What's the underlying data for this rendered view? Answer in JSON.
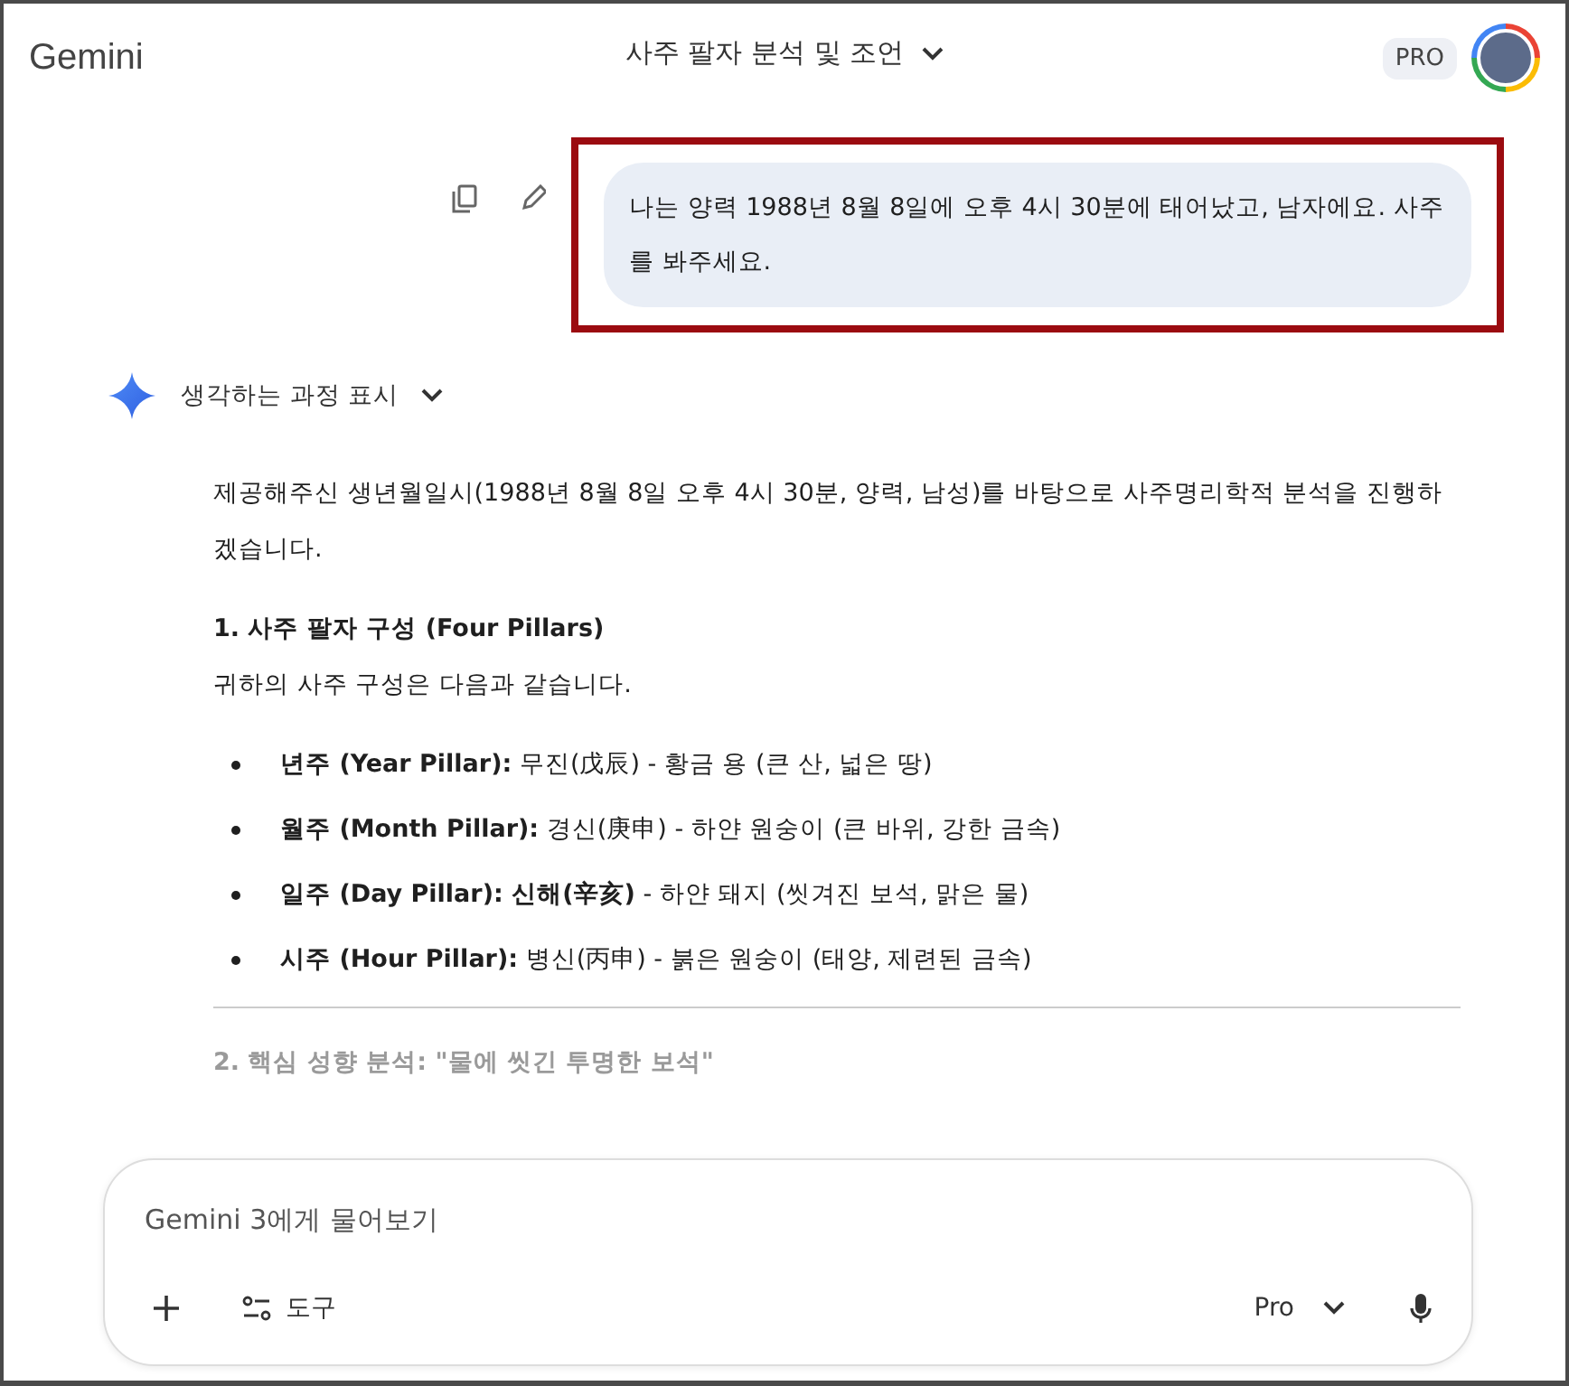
{
  "header": {
    "logo": "Gemini",
    "title": "사주 팔자 분석 및 조언",
    "badge": "PRO"
  },
  "user_message": {
    "text": "나는 양력 1988년 8월 8일에 오후 4시 30분에 태어났고, 남자에요. 사주를 봐주세요.",
    "highlighted": true
  },
  "thinking": {
    "label": "생각하는 과정 표시",
    "expanded": false
  },
  "response": [
    {
      "kind": "paragraph",
      "text": "제공해주신 생년월일시(1988년 8월 8일 오후 4시 30분, 양력, 남성)를 바탕으로 사주명리학적 분석을 진행하겠습니다."
    },
    {
      "kind": "heading",
      "text": "1. 사주 팔자 구성 (Four Pillars)"
    },
    {
      "kind": "paragraph",
      "text": "귀하의 사주 구성은 다음과 같습니다."
    },
    {
      "kind": "bullet",
      "text": "**년주 (Year Pillar):** 무진(戊辰) - 황금 용 (큰 산, 넓은 땅)"
    },
    {
      "kind": "bullet",
      "text": "**월주 (Month Pillar):** 경신(庚申) - 하얀 원숭이 (큰 바위, 강한 금속)"
    },
    {
      "kind": "bullet",
      "text": "**일주 (Day Pillar): 신해(辛亥)** - 하얀 돼지 (씻겨진 보석, 맑은 물)"
    },
    {
      "kind": "bullet",
      "text": "**시주 (Hour Pillar):** 병신(丙申) - 붉은 원숭이 (태양, 제련된 금속)"
    },
    {
      "kind": "rule"
    },
    {
      "kind": "faded_heading",
      "text": "2. 핵심 성향 분석: \"물에 씻긴 투명한 보석\""
    }
  ],
  "composer": {
    "placeholder": "Gemini 3에게 물어보기",
    "tools_label": "도구",
    "model": "Pro"
  }
}
